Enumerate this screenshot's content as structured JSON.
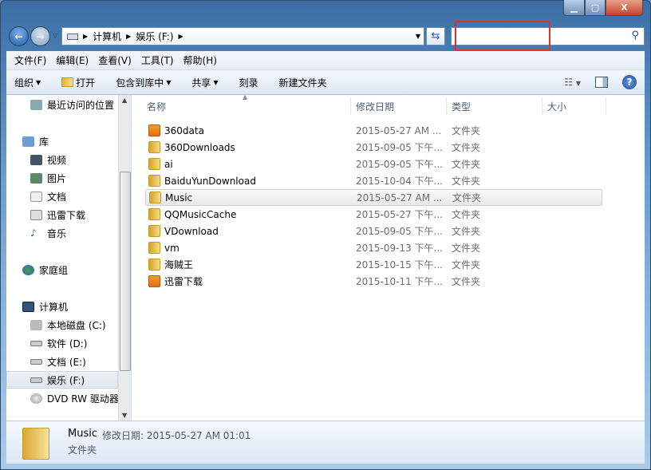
{
  "window": {
    "min_icon": "minimize-icon",
    "max_icon": "maximize-icon",
    "close_label": "X"
  },
  "nav": {
    "breadcrumb": [
      "计算机",
      "娱乐 (F:)"
    ],
    "search_placeholder": ""
  },
  "menu": [
    "文件(F)",
    "编辑(E)",
    "查看(V)",
    "工具(T)",
    "帮助(H)"
  ],
  "toolbar": {
    "organize": "组织",
    "open": "打开",
    "include": "包含到库中",
    "share": "共享",
    "burn": "刻录",
    "new_folder": "新建文件夹"
  },
  "sidebar": {
    "recent": "最近访问的位置",
    "library": "库",
    "video": "视频",
    "pictures": "图片",
    "docs": "文档",
    "xunlei": "迅雷下载",
    "music": "音乐",
    "homegroup": "家庭组",
    "computer": "计算机",
    "c": "本地磁盘 (C:)",
    "d": "软件 (D:)",
    "e": "文档 (E:)",
    "f": "娱乐 (F:)",
    "dvd": "DVD RW 驱动器"
  },
  "columns": {
    "name": "名称",
    "date": "修改日期",
    "type": "类型",
    "size": "大小"
  },
  "files": [
    {
      "name": "360data",
      "date": "2015-05-27 AM ...",
      "type": "文件夹"
    },
    {
      "name": "360Downloads",
      "date": "2015-09-05 下午...",
      "type": "文件夹"
    },
    {
      "name": "ai",
      "date": "2015-09-05 下午...",
      "type": "文件夹"
    },
    {
      "name": "BaiduYunDownload",
      "date": "2015-10-04 下午...",
      "type": "文件夹"
    },
    {
      "name": "Music",
      "date": "2015-05-27 AM ...",
      "type": "文件夹"
    },
    {
      "name": "QQMusicCache",
      "date": "2015-05-27 下午...",
      "type": "文件夹"
    },
    {
      "name": "VDownload",
      "date": "2015-09-05 下午...",
      "type": "文件夹"
    },
    {
      "name": "vm",
      "date": "2015-09-13 下午...",
      "type": "文件夹"
    },
    {
      "name": "海贼王",
      "date": "2015-10-15 下午...",
      "type": "文件夹"
    },
    {
      "name": "迅雷下载",
      "date": "2015-10-11 下午...",
      "type": "文件夹"
    }
  ],
  "details": {
    "name": "Music",
    "modified": "修改日期: 2015-05-27 AM 01:01",
    "type": "文件夹"
  }
}
